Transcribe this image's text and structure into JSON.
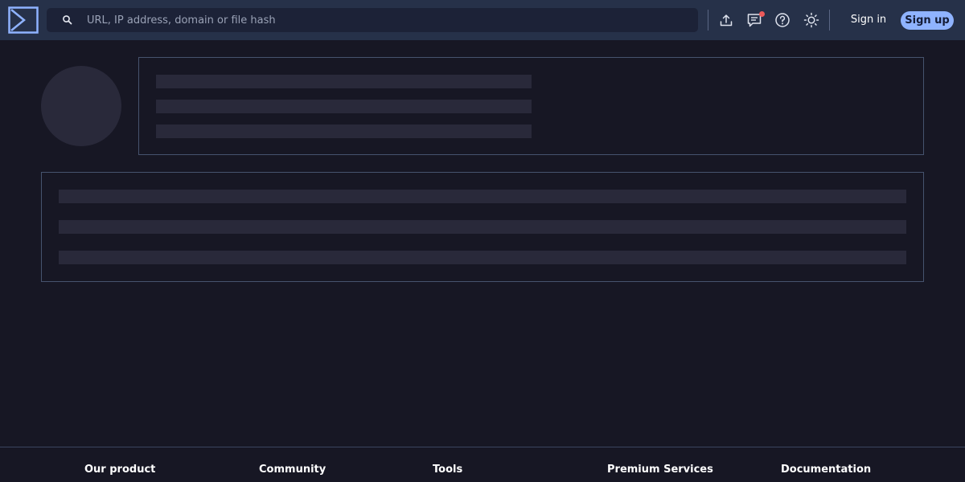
{
  "header": {
    "search": {
      "placeholder": "URL, IP address, domain or file hash",
      "value": ""
    },
    "icons": [
      "upload-icon",
      "chat-icon",
      "help-icon",
      "theme-sun-icon"
    ],
    "notification_dot_color": "#ee5a5a",
    "sign_in_label": "Sign in",
    "sign_up_label": "Sign up"
  },
  "footer": {
    "headings": [
      "Our product",
      "Community",
      "Tools",
      "Premium Services",
      "Documentation"
    ]
  },
  "colors": {
    "header_bg": "#263149",
    "page_bg": "#171724",
    "accent": "#8fb3ff",
    "skeleton": "#29293a"
  }
}
